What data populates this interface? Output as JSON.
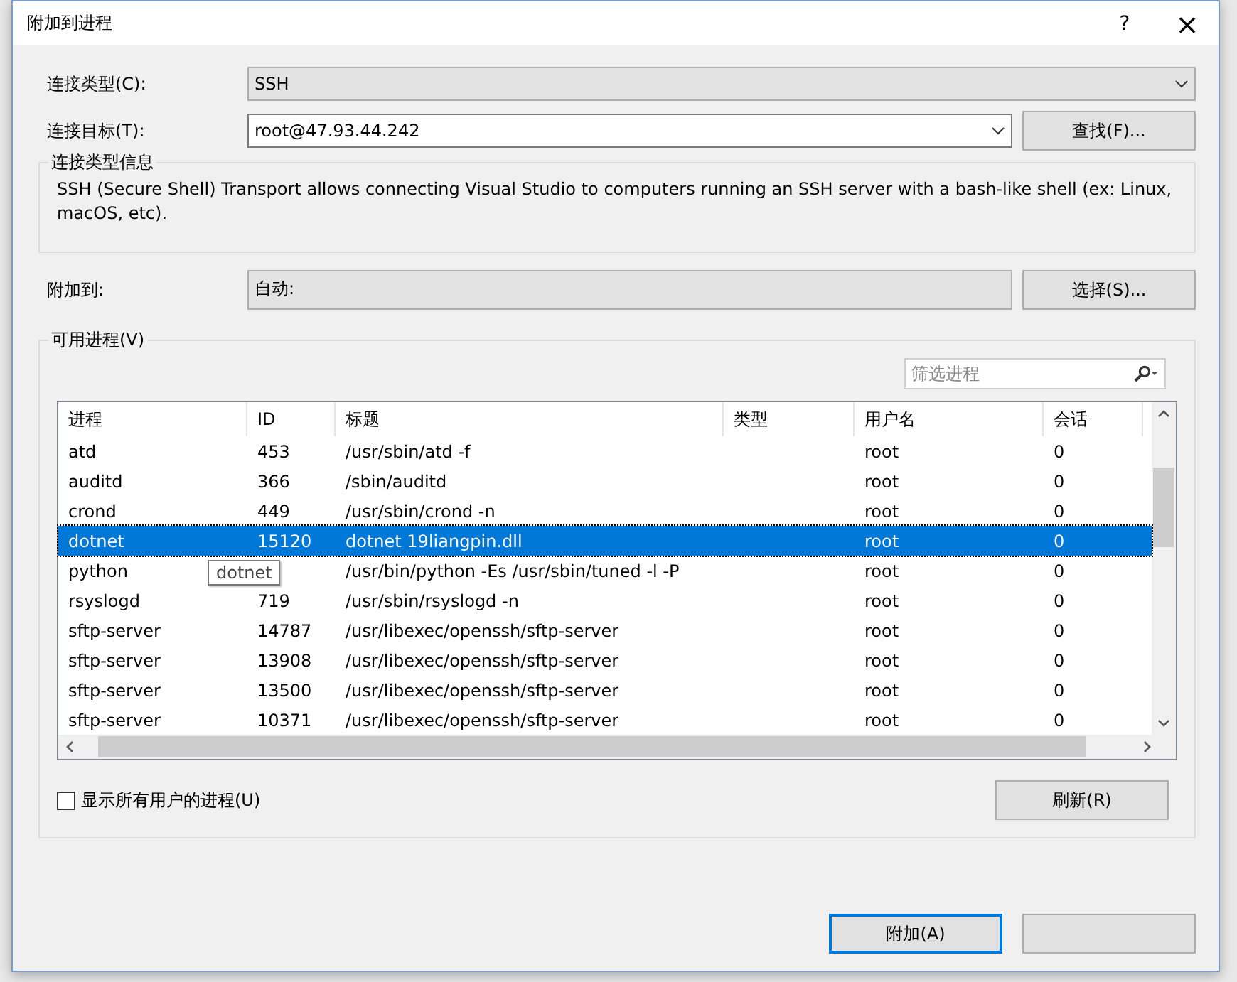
{
  "window": {
    "title": "附加到进程",
    "help": "?",
    "close": "×"
  },
  "connection_type": {
    "label": "连接类型(C):",
    "value": "SSH"
  },
  "connection_target": {
    "label": "连接目标(T):",
    "value": "root@47.93.44.242",
    "button": "查找(F)..."
  },
  "info": {
    "title": "连接类型信息",
    "text": "SSH (Secure Shell) Transport allows connecting Visual Studio to computers running an SSH server with a bash-like shell (ex: Linux, macOS, etc)."
  },
  "attach_to": {
    "label": "附加到:",
    "value": "自动:",
    "button": "选择(S)..."
  },
  "processes": {
    "title": "可用进程(V)",
    "filter_placeholder": "筛选进程",
    "columns": [
      "进程",
      "ID",
      "标题",
      "类型",
      "用户名",
      "会话"
    ],
    "rows": [
      {
        "name": "atd",
        "id": "453",
        "title": "/usr/sbin/atd -f",
        "user": "root",
        "session": "0",
        "selected": false
      },
      {
        "name": "auditd",
        "id": "366",
        "title": "/sbin/auditd",
        "user": "root",
        "session": "0",
        "selected": false
      },
      {
        "name": "crond",
        "id": "449",
        "title": "/usr/sbin/crond -n",
        "user": "root",
        "session": "0",
        "selected": false
      },
      {
        "name": "dotnet",
        "id": "15120",
        "title": "dotnet 19liangpin.dll",
        "user": "root",
        "session": "0",
        "selected": true
      },
      {
        "name": "python",
        "title": "/usr/bin/python -Es /usr/sbin/tuned -l -P",
        "user": "root",
        "session": "0",
        "selected": false,
        "tooltip": "dotnet"
      },
      {
        "name": "rsyslogd",
        "id": "719",
        "title": "/usr/sbin/rsyslogd -n",
        "user": "root",
        "session": "0",
        "selected": false
      },
      {
        "name": "sftp-server",
        "id": "14787",
        "title": "/usr/libexec/openssh/sftp-server",
        "user": "root",
        "session": "0",
        "selected": false
      },
      {
        "name": "sftp-server",
        "id": "13908",
        "title": "/usr/libexec/openssh/sftp-server",
        "user": "root",
        "session": "0",
        "selected": false
      },
      {
        "name": "sftp-server",
        "id": "13500",
        "title": "/usr/libexec/openssh/sftp-server",
        "user": "root",
        "session": "0",
        "selected": false
      },
      {
        "name": "sftp-server",
        "id": "10371",
        "title": "/usr/libexec/openssh/sftp-server",
        "user": "root",
        "session": "0",
        "selected": false
      }
    ],
    "show_all": {
      "label": "显示所有用户的进程(U)",
      "checked": false
    },
    "refresh": "刷新(R)"
  },
  "footer": {
    "attach": "附加(A)"
  }
}
